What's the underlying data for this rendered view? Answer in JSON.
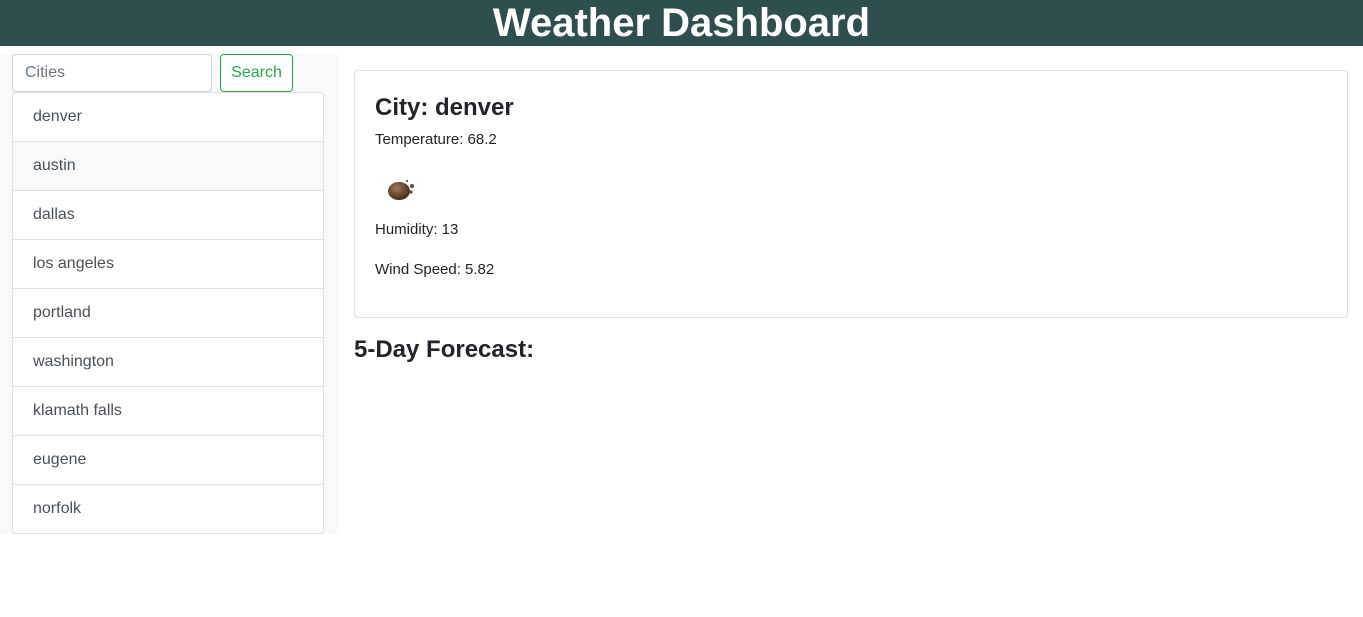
{
  "header": {
    "title": "Weather Dashboard"
  },
  "search": {
    "placeholder": "Cities",
    "value": "",
    "button_label": "Search"
  },
  "cities": [
    "denver",
    "austin",
    "dallas",
    "los angeles",
    "portland",
    "washington",
    "klamath falls",
    "eugene",
    "norfolk"
  ],
  "current": {
    "city_label": "City: denver",
    "temperature_label": "Temperature: 68.2",
    "weather_icon": "dust-haze-icon",
    "humidity_label": "Humidity: 13",
    "wind_label": "Wind Speed: 5.82"
  },
  "forecast": {
    "title": "5-Day Forecast:"
  },
  "colors": {
    "header_bg": "#2f4f4f",
    "search_accent": "#28a745",
    "sidebar_bg": "#f8f9fa"
  }
}
